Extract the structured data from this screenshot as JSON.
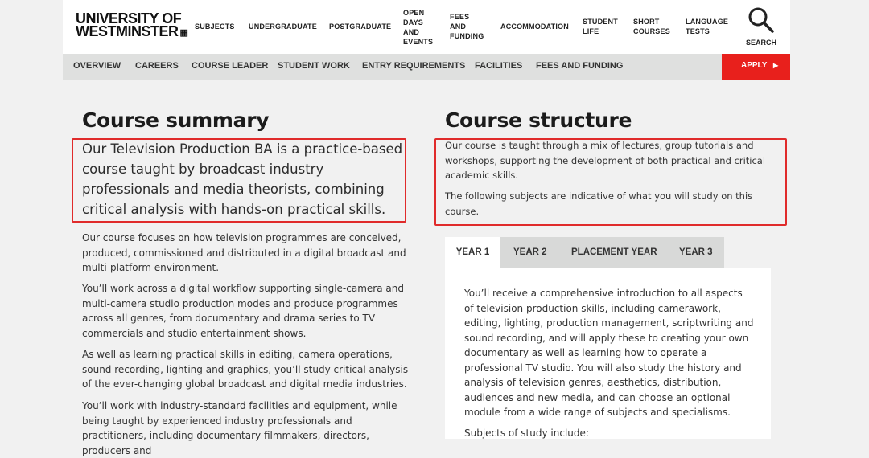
{
  "header": {
    "logo_line1": "UNIVERSITY OF",
    "logo_line2": "WESTMINSTER",
    "nav": [
      {
        "label": "SUBJECTS"
      },
      {
        "label": "UNDERGRADUATE"
      },
      {
        "label": "POSTGRADUATE"
      },
      {
        "label": "OPEN DAYS AND EVENTS"
      },
      {
        "label": "FEES AND FUNDING"
      },
      {
        "label": "ACCOMMODATION"
      },
      {
        "label": "STUDENT LIFE"
      },
      {
        "label": "SHORT COURSES"
      },
      {
        "label": "LANGUAGE TESTS"
      }
    ],
    "search_label": "SEARCH"
  },
  "subnav": {
    "items": [
      "OVERVIEW",
      "CAREERS",
      "COURSE LEADER",
      "STUDENT WORK",
      "ENTRY REQUIREMENTS",
      "FACILITIES",
      "FEES AND FUNDING"
    ],
    "apply_label": "APPLY",
    "apply_color": "#e8201c"
  },
  "summary": {
    "title": "Course summary",
    "lead": "Our Television Production BA is a practice-based course taught by broadcast industry professionals and media theorists, combining critical analysis with hands-on practical skills.",
    "paragraphs": [
      "Our course focuses on how television programmes are conceived, produced, commissioned and distributed in a digital broadcast and multi-platform environment.",
      "You’ll work across a digital workflow supporting single-camera and multi-camera studio production modes and produce programmes across all genres, from documentary and drama series to TV commercials and studio entertainment shows.",
      "As well as learning practical skills in editing, camera operations, sound recording, lighting and graphics, you’ll study critical analysis of the ever-changing global broadcast and digital media industries.",
      "You’ll work with industry-standard facilities and equipment, while being taught by experienced industry professionals and practitioners, including documentary filmmakers, directors, producers and"
    ]
  },
  "structure": {
    "title": "Course structure",
    "intro1": "Our course is taught through a mix of lectures, group tutorials and workshops, supporting the development of both practical and critical academic skills.",
    "intro2": "The following subjects are indicative of what you will study on this course.",
    "tabs": [
      "YEAR 1",
      "YEAR 2",
      "PLACEMENT YEAR",
      "YEAR 3"
    ],
    "active_tab": "YEAR 1",
    "panel_text": "You’ll receive a comprehensive introduction to all aspects of television production skills, including camerawork, editing, lighting, production management, scriptwriting and sound recording, and will apply these to creating your own documentary as well as learning how to operate a professional TV studio. You will also study the history and analysis of television genres, aesthetics, distribution, audiences and new media, and can choose an optional module from a wide range of subjects and specialisms.",
    "panel_subtitle": "Subjects of study include:"
  },
  "highlight_color": "#e02b2b"
}
